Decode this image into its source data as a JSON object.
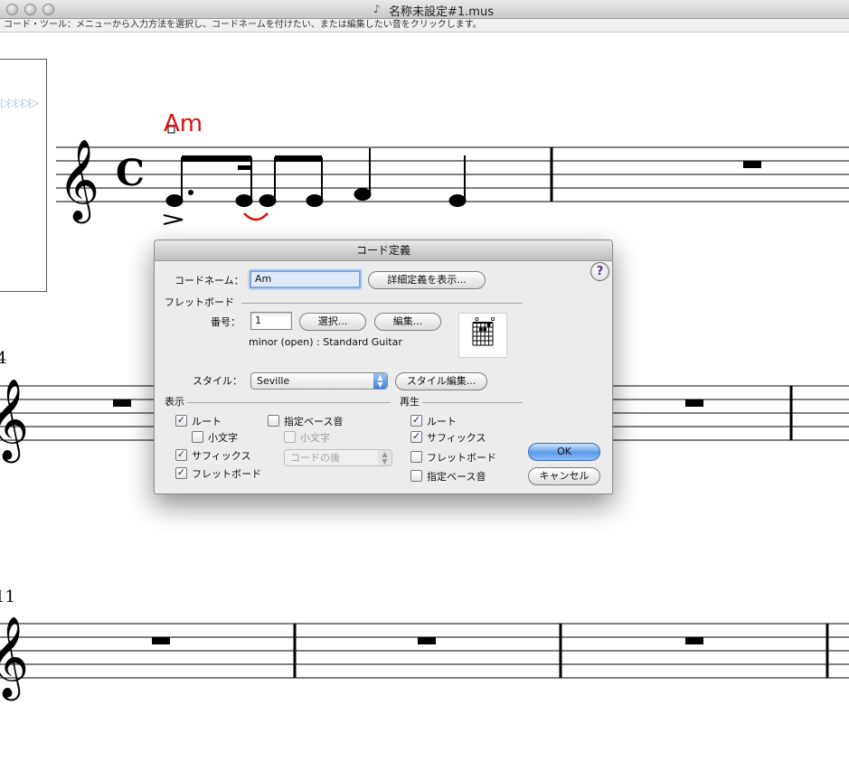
{
  "window": {
    "title": "名称未設定#1.mus",
    "status": "コード・ツール：メニューから入力方法を選択し、コードネームを付けたい、または編集したい音をクリックします。"
  },
  "score": {
    "chord_symbol": "Am",
    "measure_numbers": [
      "4",
      "11"
    ],
    "time_signature": "C",
    "colors": {
      "chord": "#e01010",
      "slur": "#e01010"
    }
  },
  "dialog": {
    "title": "コード定義",
    "help_label": "?",
    "chord_name_label": "コードネーム：",
    "chord_name_value": "Am",
    "show_advanced_button": "詳細定義を表示...",
    "fretboard_section": "フレットボード",
    "number_label": "番号：",
    "number_value": "1",
    "select_button": "選択...",
    "edit_button": "編集...",
    "fretboard_description": "minor (open) : Standard Guitar",
    "style_label": "スタイル：",
    "style_value": "Seville",
    "style_edit_button": "スタイル編集...",
    "display_section": "表示",
    "playback_section": "再生",
    "display": {
      "root": "ルート",
      "lowercase": "小文字",
      "suffix": "サフィックス",
      "fretboard": "フレットボード",
      "alt_bass": "指定ベース音",
      "alt_bass_lowercase": "小文字",
      "alt_bass_position": "コードの後"
    },
    "playback": {
      "root": "ルート",
      "suffix": "サフィックス",
      "fretboard": "フレットボード",
      "alt_bass": "指定ベース音"
    },
    "ok_button": "OK",
    "cancel_button": "キャンセル",
    "checked_glyph": "✓"
  }
}
